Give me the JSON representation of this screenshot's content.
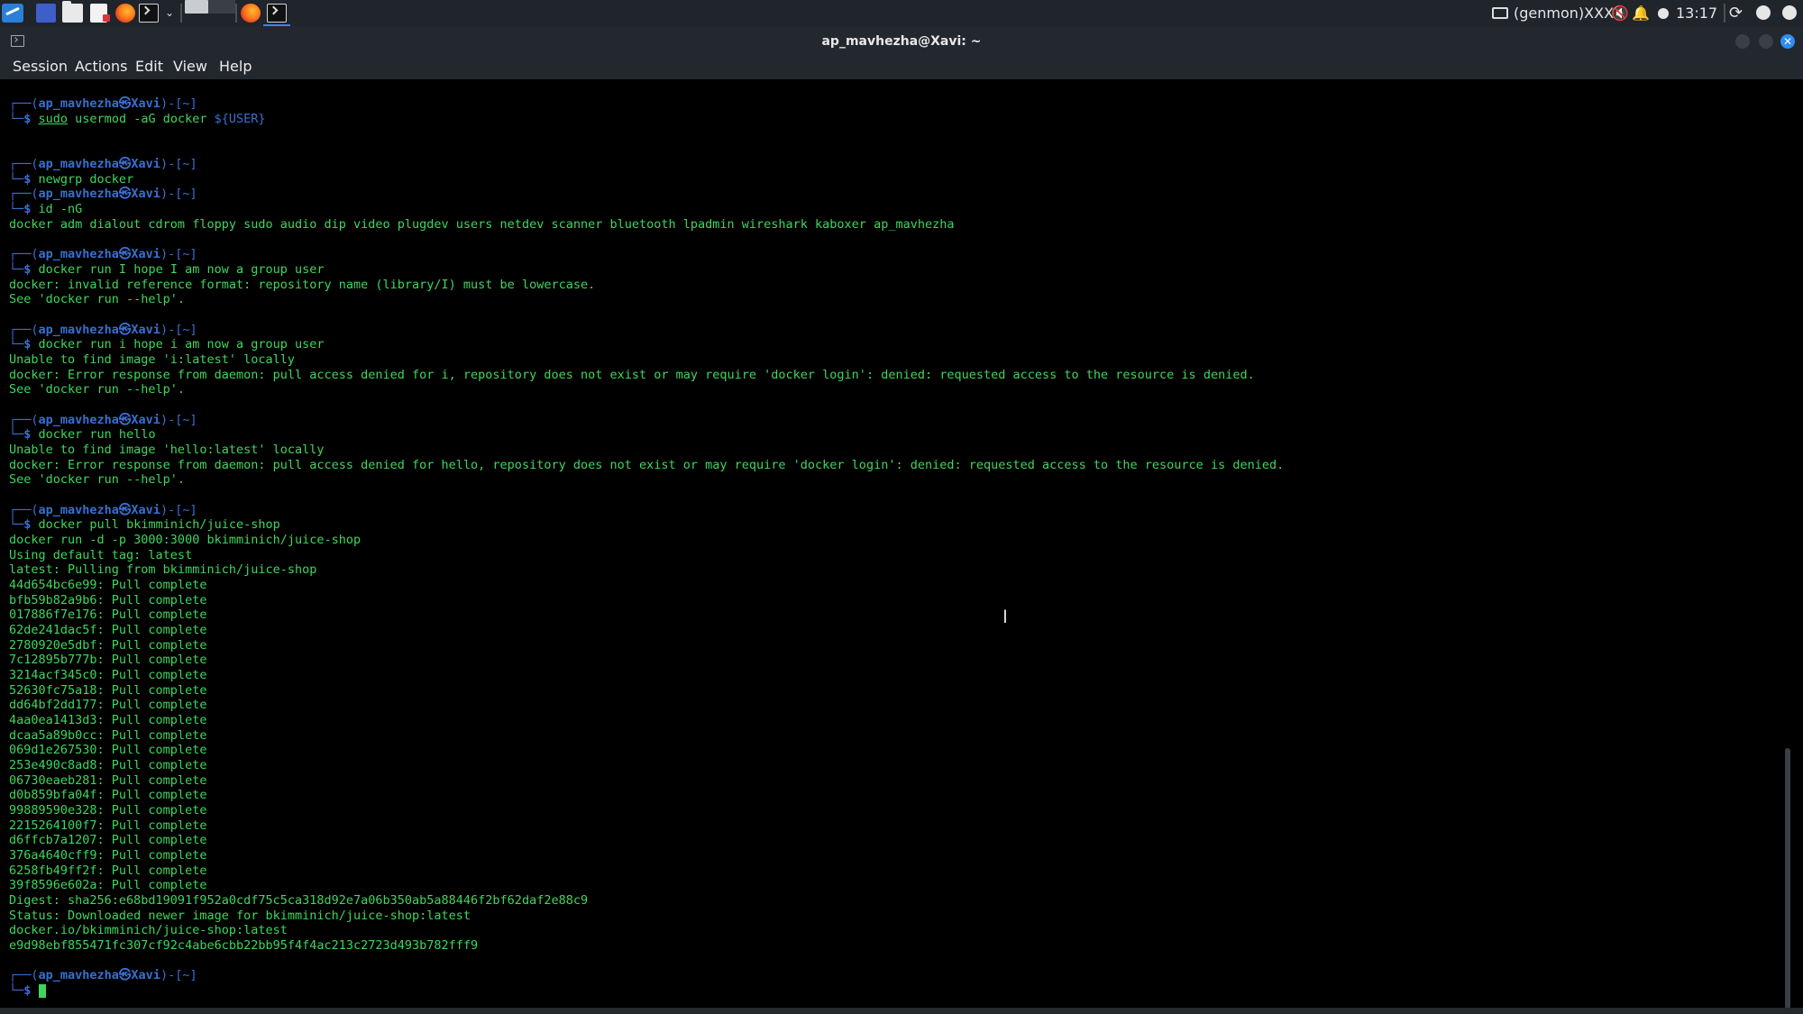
{
  "panel": {
    "genmon": "(genmon)XXX",
    "clock": "13:17"
  },
  "window": {
    "title": "ap_mavhezha@Xavi: ~",
    "close_glyph": "✕"
  },
  "menu": [
    "Session",
    "Actions",
    "Edit",
    "View",
    "Help"
  ],
  "prompt": {
    "top_left": "┌──(",
    "user": "ap_mavhezha",
    "at": "㉿",
    "host": "Xavi",
    "dir_part": ")-[",
    "cwd": "~",
    "end": "]",
    "bottom": "└─",
    "dollar": "$ "
  },
  "terminal": {
    "cmd_sudo_word": "sudo",
    "cmd_sudo_rest": " usermod -aG docker ",
    "cmd_sudo_var": "${USER}",
    "cmd_newgrp": "newgrp docker",
    "cmd_id": "id -nG",
    "out_id": "docker adm dialout cdrom floppy sudo audio dip video plugdev users netdev scanner bluetooth lpadmin wireshark kaboxer ap_mavhezha",
    "cmd_run1": "docker run I hope I am now a group user",
    "out_run1_a": "docker: invalid reference format: repository name (library/I) must be lowercase.",
    "out_run1_b": "See 'docker run --help'.",
    "cmd_run2": "docker run i hope i am now a group user",
    "out_run2_a": "Unable to find image 'i:latest' locally",
    "out_run2_b": "docker: Error response from daemon: pull access denied for i, repository does not exist or may require 'docker login': denied: requested access to the resource is denied.",
    "out_run2_c": "See 'docker run --help'.",
    "cmd_run3": "docker run hello",
    "out_run3_a": "Unable to find image 'hello:latest' locally",
    "out_run3_b": "docker: Error response from daemon: pull access denied for hello, repository does not exist or may require 'docker login': denied: requested access to the resource is denied.",
    "out_run3_c": "See 'docker run --help'.",
    "cmd_pull": "docker pull bkimminich/juice-shop",
    "out_pull_cmd": "docker run -d -p 3000:3000 bkimminich/juice-shop",
    "out_tag": "Using default tag: latest",
    "out_pulling": "latest: Pulling from bkimminich/juice-shop",
    "layers": [
      "44d654bc6e99: Pull complete",
      "bfb59b82a9b6: Pull complete",
      "017886f7e176: Pull complete",
      "62de241dac5f: Pull complete",
      "2780920e5dbf: Pull complete",
      "7c12895b777b: Pull complete",
      "3214acf345c0: Pull complete",
      "52630fc75a18: Pull complete",
      "dd64bf2dd177: Pull complete",
      "4aa0ea1413d3: Pull complete",
      "dcaa5a89b0cc: Pull complete",
      "069d1e267530: Pull complete",
      "253e490c8ad8: Pull complete",
      "06730eaeb281: Pull complete",
      "d0b859bfa04f: Pull complete",
      "99889590e328: Pull complete",
      "2215264100f7: Pull complete",
      "d6ffcb7a1207: Pull complete",
      "376a4640cff9: Pull complete",
      "6258fb49ff2f: Pull complete",
      "39f8596e602a: Pull complete"
    ],
    "out_digest": "Digest: sha256:e68bd19091f952a0cdf75c5ca318d92e7a06b350ab5a88446f2bf62daf2e88c9",
    "out_status": "Status: Downloaded newer image for bkimminich/juice-shop:latest",
    "out_ref": "docker.io/bkimminich/juice-shop:latest",
    "out_hash": "e9d98ebf855471fc307cf92c4abe6cbb22bb95f4f4ac213c2723d493b782fff9"
  },
  "icons": {
    "mouse_cursor": "Ⅰ",
    "chevron": "⌄",
    "mute": "🔇",
    "bell": "🔔",
    "refresh": "⟳"
  },
  "colors": {
    "prompt_blue": "#3a6fd1",
    "terminal_green": "#3fd65c",
    "background": "#000000"
  }
}
